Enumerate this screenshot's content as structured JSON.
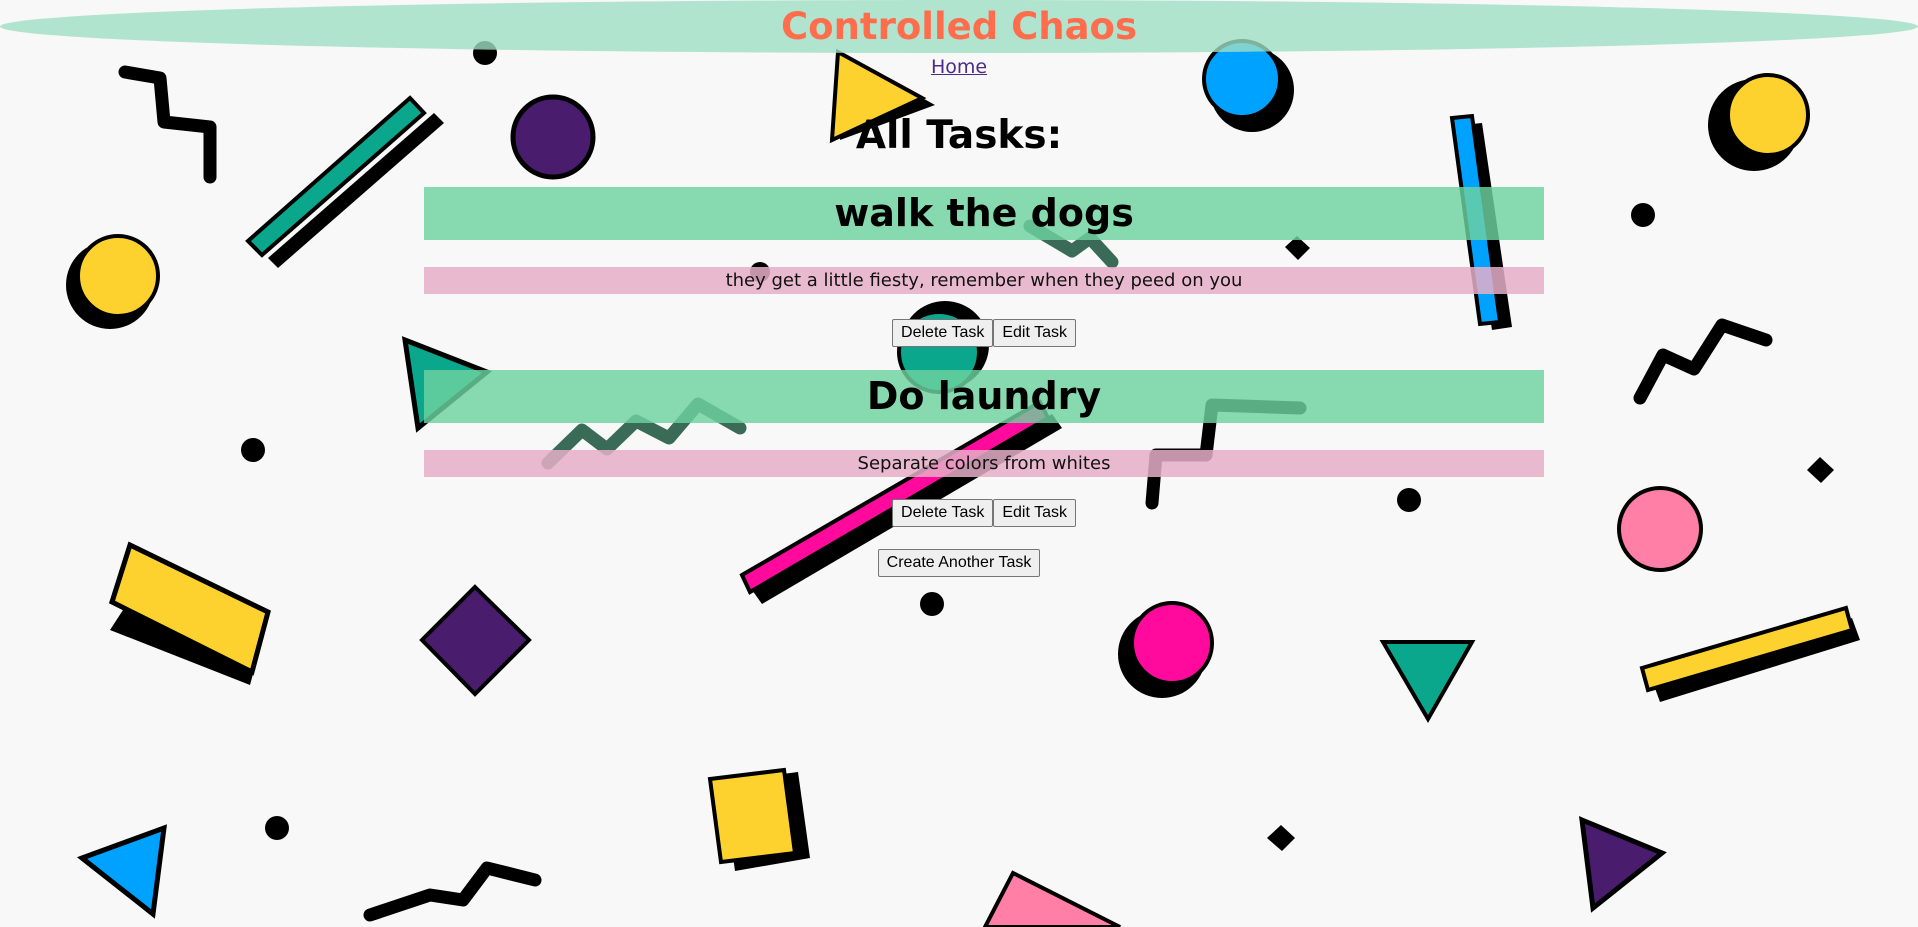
{
  "header": {
    "title": "Controlled Chaos",
    "title_color": "#ff6d4d",
    "bg_color": "#9ddec3"
  },
  "nav": {
    "home_label": "Home"
  },
  "page": {
    "heading": "All Tasks:"
  },
  "tasks": [
    {
      "title": "walk the dogs",
      "description": "they get a little fiesty, remember when they peed on you",
      "delete_label": "Delete Task",
      "edit_label": "Edit Task"
    },
    {
      "title": "Do laundry",
      "description": "Separate colors from whites",
      "delete_label": "Delete Task",
      "edit_label": "Edit Task"
    }
  ],
  "actions": {
    "create_label": "Create Another Task"
  },
  "colors": {
    "background": "#f8f8f8",
    "title_band": "#6ed2a0",
    "description_band": "#e6afc8",
    "shape_yellow": "#fdd22f",
    "shape_teal": "#0aa78c",
    "shape_purple": "#4a1c6e",
    "shape_blue": "#00a2ff",
    "shape_pink": "#ff7fa7",
    "shape_magenta": "#ff0a9c"
  }
}
